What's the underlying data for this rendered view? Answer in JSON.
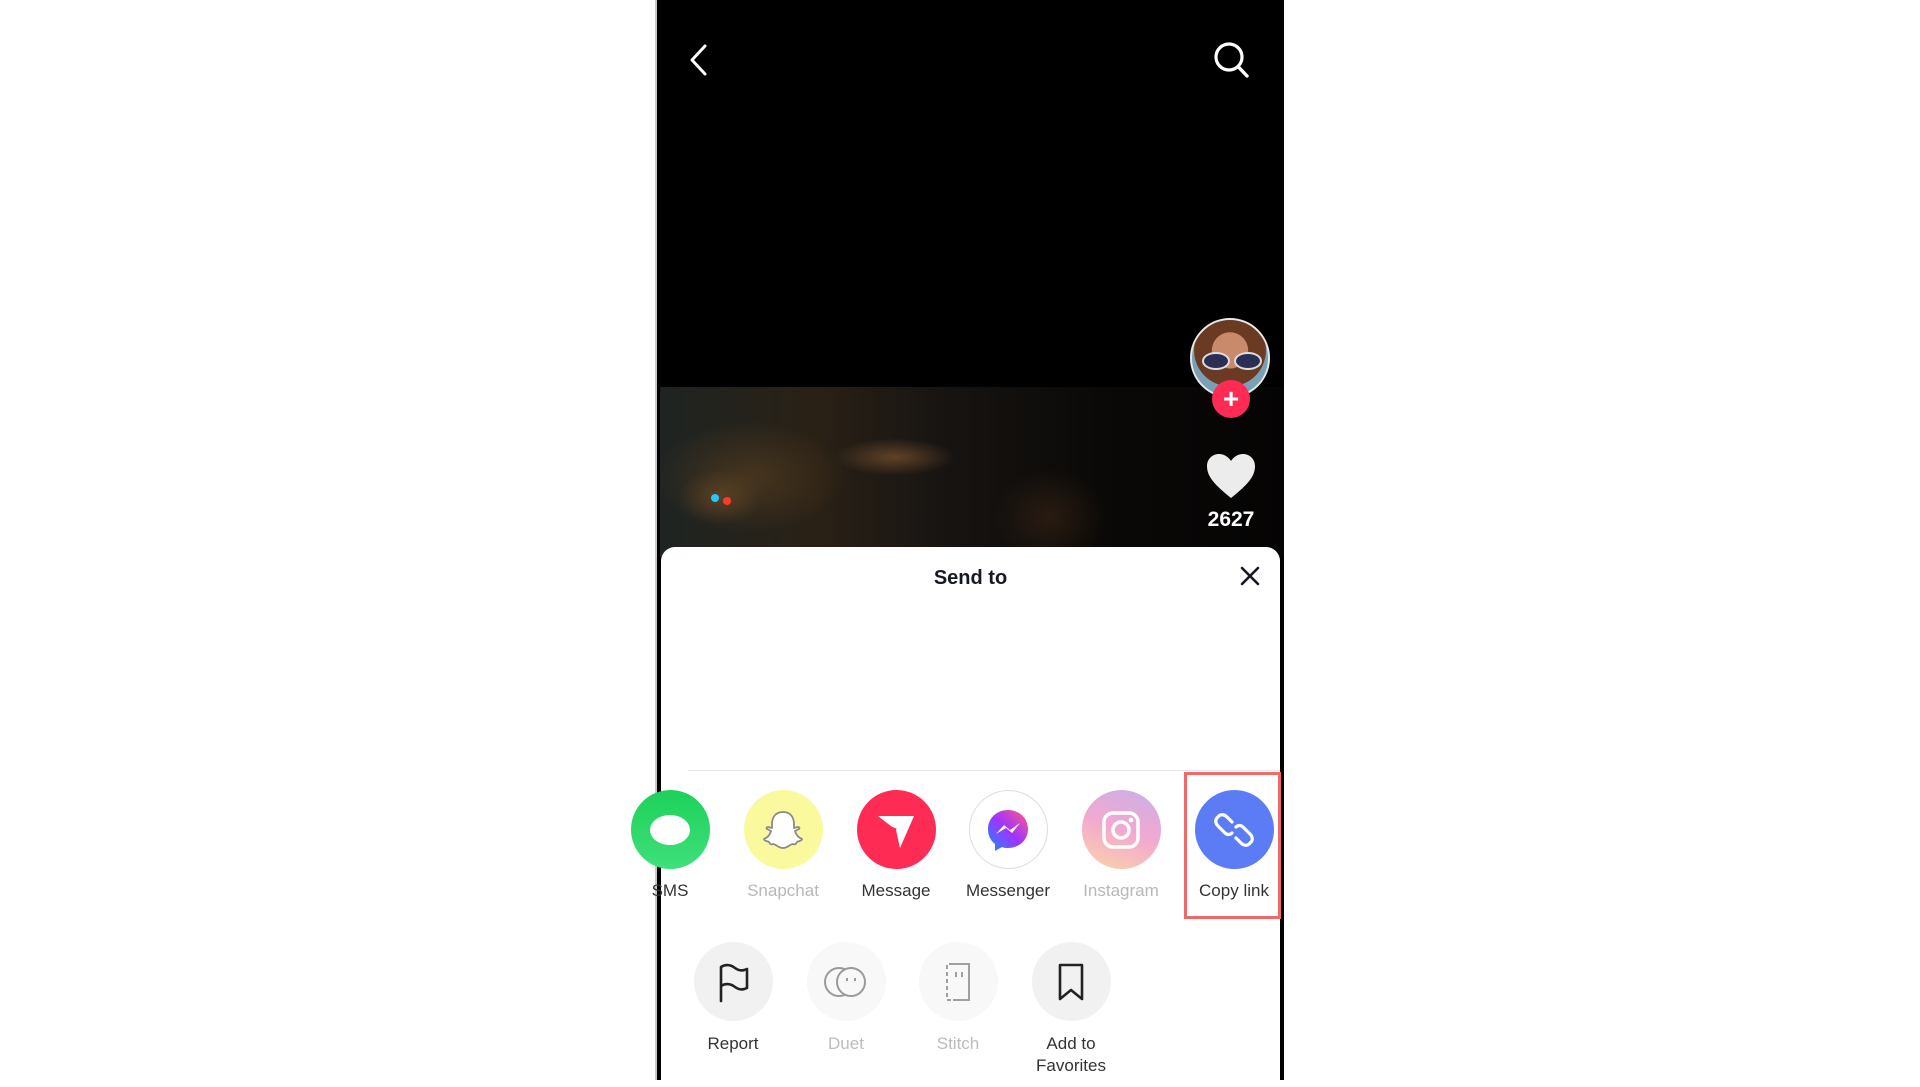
{
  "top_bar": {
    "back_icon": "chevron-left-icon",
    "search_icon": "search-icon"
  },
  "side_actions": {
    "avatar_alt": "creator avatar",
    "follow_icon": "+",
    "like_icon": "heart-icon",
    "like_count": "2627"
  },
  "share_sheet": {
    "title": "Send to",
    "close_icon": "close-icon",
    "share_targets": [
      {
        "label": "SMS",
        "icon": "sms-icon",
        "color": "#25d366",
        "muted": false
      },
      {
        "label": "Snapchat",
        "icon": "snapchat-ghost-icon",
        "color": "#fffc9a",
        "muted": true
      },
      {
        "label": "Message",
        "icon": "paper-plane-icon",
        "color": "#fe2c55",
        "muted": false
      },
      {
        "label": "Messenger",
        "icon": "messenger-icon",
        "color": "#ffffff",
        "muted": false
      },
      {
        "label": "Instagram",
        "icon": "instagram-icon",
        "color": "#e8a5c8",
        "muted": true
      },
      {
        "label": "Copy link",
        "icon": "link-icon",
        "color": "#5b7cf5",
        "muted": false,
        "highlighted": true
      }
    ],
    "actions": [
      {
        "label": "Report",
        "icon": "flag-icon",
        "muted": false
      },
      {
        "label": "Duet",
        "icon": "duet-icon",
        "muted": true
      },
      {
        "label": "Stitch",
        "icon": "stitch-icon",
        "muted": true
      },
      {
        "label": "Add to",
        "label_line2": "Favorites",
        "icon": "bookmark-icon",
        "muted": false
      }
    ]
  },
  "colors": {
    "accent": "#fe2c55",
    "copy_link": "#5b7cf5",
    "highlight_box": "#ef6b6b"
  }
}
